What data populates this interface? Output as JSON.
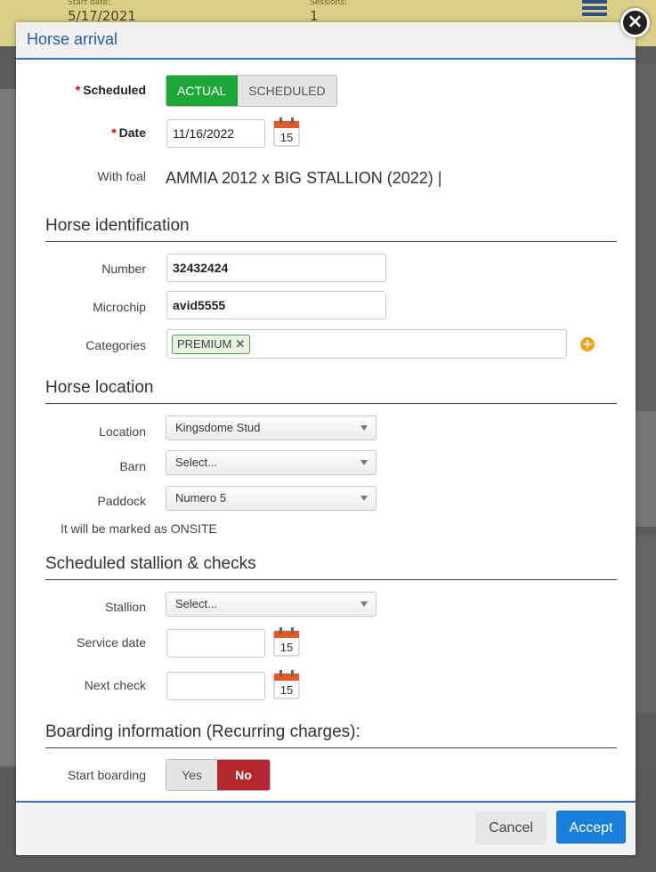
{
  "background": {
    "start_date_label": "Start date:",
    "start_date": "5/17/2021",
    "sessions_label": "Sessions:",
    "sessions": "1"
  },
  "modal": {
    "title": "Horse arrival",
    "close_symbol": "×"
  },
  "fields": {
    "scheduled_label": "Scheduled",
    "scheduled_options": [
      "ACTUAL",
      "SCHEDULED"
    ],
    "scheduled_selected": "ACTUAL",
    "date_label": "Date",
    "date_value": "11/16/2022",
    "calendar_day": "15",
    "with_foal_label": "With foal",
    "with_foal_value": "AMMIA 2012 x BIG STALLION (2022) |"
  },
  "identification": {
    "heading": "Horse identification",
    "number_label": "Number",
    "number_value": "32432424",
    "microchip_label": "Microchip",
    "microchip_value": "avid5555",
    "categories_label": "Categories",
    "categories": [
      "PREMIUM"
    ],
    "add_symbol": "+"
  },
  "location": {
    "heading": "Horse location",
    "location_label": "Location",
    "location_value": "Kingsdome Stud",
    "barn_label": "Barn",
    "barn_value": "Select...",
    "paddock_label": "Paddock",
    "paddock_value": "Numero 5",
    "onsite_note": "It will be marked as ONSITE"
  },
  "stallion": {
    "heading": "Scheduled stallion & checks",
    "stallion_label": "Stallion",
    "stallion_value": "Select...",
    "service_date_label": "Service date",
    "service_date_value": "",
    "next_check_label": "Next check",
    "next_check_value": ""
  },
  "boarding": {
    "heading": "Boarding information (Recurring charges):",
    "start_label": "Start boarding",
    "options": [
      "Yes",
      "No"
    ],
    "selected": "No"
  },
  "footer": {
    "cancel_label": "Cancel",
    "accept_label": "Accept"
  },
  "colors": {
    "accent_blue": "#2a5aa8",
    "toggle_green": "#1ea83a",
    "toggle_red": "#b5262d",
    "accept_blue": "#1a7fdc"
  }
}
